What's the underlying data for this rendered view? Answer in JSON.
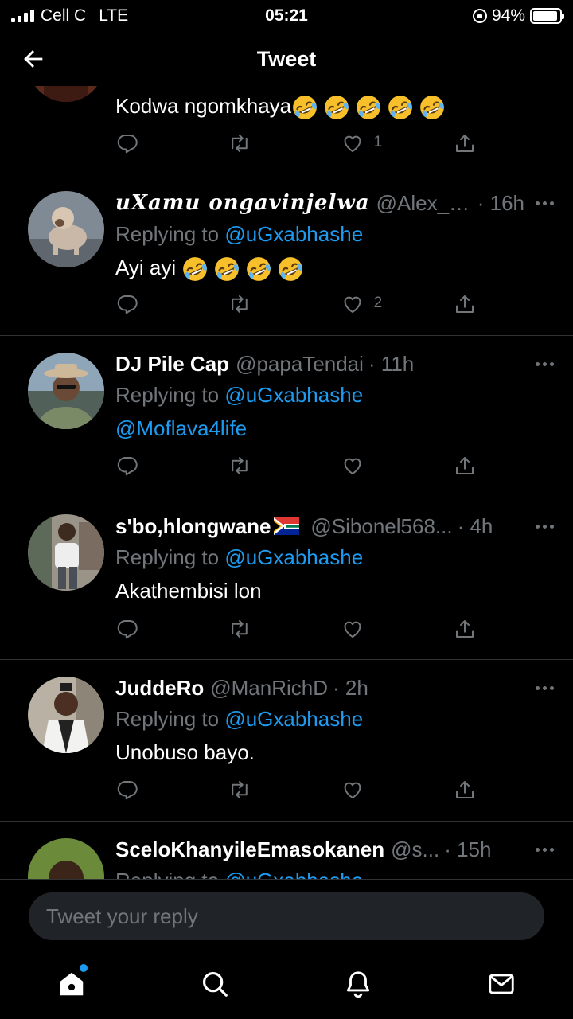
{
  "status_bar": {
    "carrier": "Cell C",
    "network": "LTE",
    "time": "05:21",
    "battery": "94%",
    "battery_level": 0.94
  },
  "header": {
    "title": "Tweet",
    "back_icon": "arrow-left-icon"
  },
  "partial_tweet": {
    "text": "Kodwa ngomkhaya",
    "emoji_count": 5,
    "reply_count": "",
    "retweet_count": "",
    "like_count": "1"
  },
  "tweets": [
    {
      "display_name": "uXamu ongavinjelwa",
      "handle": "@Alex__L...",
      "time": "· 16h",
      "replying_prefix": "Replying to ",
      "replying_to": "@uGxabhashe",
      "text": "Ayi ayi",
      "emoji_count": 4,
      "like_count": "2"
    },
    {
      "display_name": "DJ Pile Cap",
      "handle": "@papaTendai",
      "time": "· 11h",
      "replying_prefix": "Replying to ",
      "replying_to": "@uGxabhashe",
      "text": "@Moflava4life",
      "like_count": ""
    },
    {
      "display_name": "s'bo,hlongwane",
      "handle": "@Sibonel568...",
      "time": "· 4h",
      "replying_prefix": "Replying to ",
      "replying_to": "@uGxabhashe",
      "text": "Akathembisi lon",
      "like_count": ""
    },
    {
      "display_name": "JuddeRo",
      "handle": "@ManRichD",
      "time": "· 2h",
      "replying_prefix": "Replying to ",
      "replying_to": "@uGxabhashe",
      "text": "Unobuso bayo.",
      "like_count": ""
    },
    {
      "display_name": "ScelоKhanyileEmasokanen",
      "handle": "@s...",
      "time": "· 15h",
      "replying_prefix": "Replying to ",
      "replying_to": "@uGxabhashe",
      "text": ""
    }
  ],
  "reply_bar": {
    "placeholder": "Tweet your reply"
  },
  "tab_bar": {
    "items": [
      "home-icon",
      "search-icon",
      "notifications-icon",
      "messages-icon"
    ]
  },
  "colors": {
    "accent": "#1d9bf0",
    "secondary_text": "#71767b",
    "divider": "#2f3336",
    "background": "#000000"
  }
}
